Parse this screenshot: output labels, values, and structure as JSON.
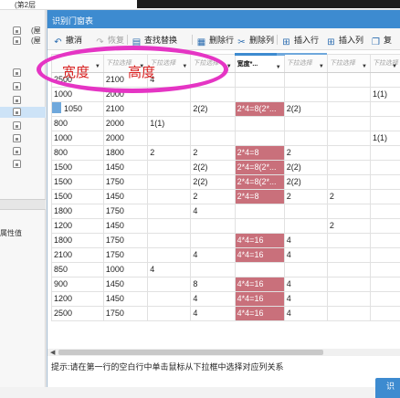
{
  "background": {
    "top_label": "(第2层",
    "tree": [
      {
        "text": "(屋"
      },
      {
        "text": "(屋"
      },
      {
        "text": ""
      },
      {
        "text": ""
      },
      {
        "text": ""
      },
      {
        "text": "",
        "selected": true
      },
      {
        "text": ""
      },
      {
        "text": ""
      },
      {
        "text": ""
      },
      {
        "text": ""
      }
    ],
    "attr_label": "属性值"
  },
  "dialog": {
    "title": "识别门窗表",
    "toolbar": [
      {
        "label": "撤消",
        "icon": "undo-icon",
        "glyph": "↶",
        "enabled": true
      },
      {
        "label": "恢复",
        "icon": "redo-icon",
        "glyph": "↷",
        "enabled": false
      },
      {
        "label": "查找替换",
        "icon": "find-replace-icon",
        "glyph": "▤",
        "enabled": true
      },
      {
        "label": "删除行",
        "icon": "delete-row-icon",
        "glyph": "▦",
        "enabled": true
      },
      {
        "label": "删除列",
        "icon": "delete-column-icon",
        "glyph": "✂",
        "enabled": true
      },
      {
        "label": "插入行",
        "icon": "insert-row-icon",
        "glyph": "⊞",
        "enabled": true
      },
      {
        "label": "插入列",
        "icon": "insert-column-icon",
        "glyph": "⊞",
        "enabled": true
      },
      {
        "label": "复",
        "icon": "copy-icon",
        "glyph": "❐",
        "enabled": true
      }
    ],
    "columns": [
      {
        "header": "宽度",
        "type": "select"
      },
      {
        "header": "下拉选择",
        "type": "select"
      },
      {
        "header": "下拉选择",
        "type": "select"
      },
      {
        "header": "下拉选择",
        "type": "select"
      },
      {
        "header": "宽度*...",
        "type": "select",
        "active": true
      },
      {
        "header": "下拉选择",
        "type": "select"
      },
      {
        "header": "下拉选择",
        "type": "select"
      },
      {
        "header": "下拉选择",
        "type": "select"
      }
    ],
    "rows": [
      {
        "cells": [
          "2500",
          "2100",
          "4",
          "",
          "",
          "",
          "",
          ""
        ],
        "pink": []
      },
      {
        "cells": [
          "1000",
          "2000",
          "",
          "",
          "",
          "",
          "",
          "1(1)"
        ],
        "pink": []
      },
      {
        "cells": [
          "1050",
          "2100",
          "",
          "2(2)",
          "2*4=8(2*...",
          "2(2)",
          "",
          ""
        ],
        "pink": [
          4
        ],
        "selected": true
      },
      {
        "cells": [
          "800",
          "2000",
          "1(1)",
          "",
          "",
          "",
          "",
          ""
        ],
        "pink": []
      },
      {
        "cells": [
          "1000",
          "2000",
          "",
          "",
          "",
          "",
          "",
          "1(1)"
        ],
        "pink": []
      },
      {
        "cells": [
          "800",
          "1800",
          "2",
          "2",
          "2*4=8",
          "2",
          "",
          ""
        ],
        "pink": [
          4
        ]
      },
      {
        "cells": [
          "1500",
          "1450",
          "",
          "2(2)",
          "2*4=8(2*...",
          "2(2)",
          "",
          ""
        ],
        "pink": [
          4
        ]
      },
      {
        "cells": [
          "1500",
          "1750",
          "",
          "2(2)",
          "2*4=8(2*...",
          "2(2)",
          "",
          ""
        ],
        "pink": [
          4
        ]
      },
      {
        "cells": [
          "1500",
          "1450",
          "",
          "2",
          "2*4=8",
          "2",
          "2",
          ""
        ],
        "pink": [
          4
        ]
      },
      {
        "cells": [
          "1800",
          "1750",
          "",
          "4",
          "",
          "",
          "",
          ""
        ],
        "pink": []
      },
      {
        "cells": [
          "1200",
          "1450",
          "",
          "",
          "",
          "",
          "2",
          ""
        ],
        "pink": []
      },
      {
        "cells": [
          "1800",
          "1750",
          "",
          "",
          "4*4=16",
          "4",
          "",
          ""
        ],
        "pink": [
          4
        ]
      },
      {
        "cells": [
          "2100",
          "1750",
          "",
          "4",
          "4*4=16",
          "4",
          "",
          ""
        ],
        "pink": [
          4
        ]
      },
      {
        "cells": [
          "850",
          "1000",
          "4",
          "",
          "",
          "",
          "",
          ""
        ],
        "pink": []
      },
      {
        "cells": [
          "900",
          "1450",
          "",
          "8",
          "4*4=16",
          "4",
          "",
          ""
        ],
        "pink": [
          4
        ]
      },
      {
        "cells": [
          "1200",
          "1450",
          "",
          "4",
          "4*4=16",
          "4",
          "",
          ""
        ],
        "pink": [
          4
        ]
      },
      {
        "cells": [
          "2500",
          "1750",
          "",
          "4",
          "4*4=16",
          "4",
          "",
          ""
        ],
        "pink": [
          4
        ]
      }
    ],
    "hint": "提示:请在第一行的空白行中单击鼠标从下拉框中选择对应列关系",
    "ok_label": "识"
  },
  "annotation": {
    "handwritten": [
      "宽度",
      "高度"
    ],
    "color": "#e535c4"
  }
}
